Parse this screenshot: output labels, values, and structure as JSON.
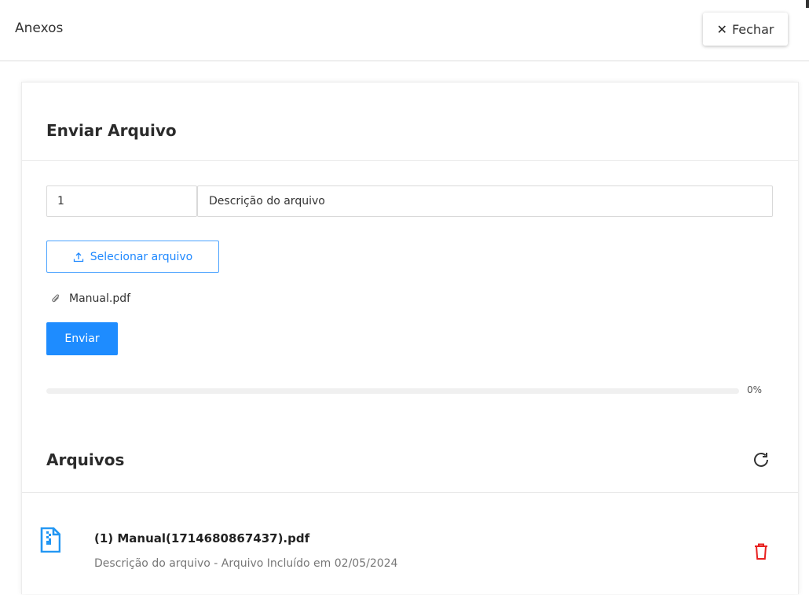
{
  "header": {
    "title": "Anexos",
    "close_label": "Fechar"
  },
  "upload": {
    "title": "Enviar Arquivo",
    "sequence_value": "1",
    "description_value": "Descrição do arquivo",
    "select_label": "Selecionar arquivo",
    "selected_file": "Manual.pdf",
    "send_label": "Enviar",
    "progress_percent": 0,
    "progress_text": "0%"
  },
  "files": {
    "title": "Arquivos",
    "items": [
      {
        "name": "(1) Manual(1714680867437).pdf",
        "description": "Descrição do arquivo - Arquivo Incluído em 02/05/2024"
      }
    ]
  },
  "colors": {
    "primary": "#1e8cff",
    "danger": "#e8201f"
  },
  "icons": {
    "close": "close-icon",
    "upload": "upload-icon",
    "attachment": "paperclip-icon",
    "refresh": "refresh-icon",
    "document": "zip-document-icon",
    "delete": "trash-icon"
  }
}
